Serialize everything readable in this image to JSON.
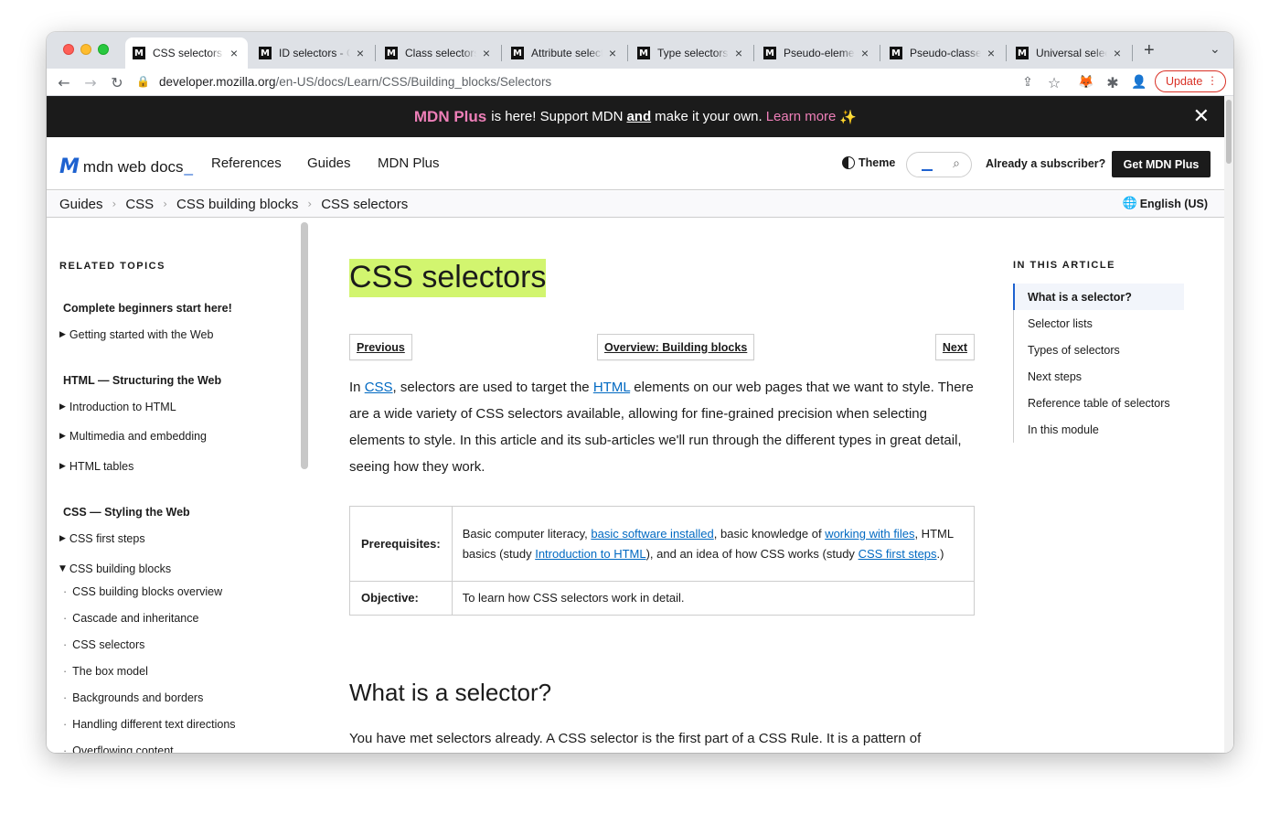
{
  "browser": {
    "tabs": [
      {
        "title": "CSS selectors - Learn web development",
        "active": true
      },
      {
        "title": "ID selectors - CSS: Cascading Style Sheets",
        "active": false
      },
      {
        "title": "Class selectors - CSS",
        "active": false
      },
      {
        "title": "Attribute selectors",
        "active": false
      },
      {
        "title": "Type selectors - CSS",
        "active": false
      },
      {
        "title": "Pseudo-elements - CSS",
        "active": false
      },
      {
        "title": "Pseudo-classes - CSS",
        "active": false
      },
      {
        "title": "Universal selectors",
        "active": false
      }
    ],
    "favicon_glyph": "M",
    "close_glyph": "×",
    "new_tab_glyph": "+",
    "tab_menu_glyph": "⌄",
    "back_glyph": "←",
    "forward_glyph": "→",
    "reload_glyph": "↻",
    "lock_glyph": "🔒",
    "url_host": "developer.mozilla.org",
    "url_path": "/en-US/docs/Learn/CSS/Building_blocks/Selectors",
    "share_glyph": "⇪",
    "star_glyph": "☆",
    "fox_glyph": "🦊",
    "puzzle_glyph": "✱",
    "avatar_glyph": "👤",
    "update_label": "Update",
    "update_menu_glyph": "⋮"
  },
  "banner": {
    "brand": "MDN Plus",
    "text_1": "is here! Support MDN",
    "and": "and",
    "text_2": "make it your own.",
    "learn_more": "Learn more",
    "sparkle": "✨",
    "close_glyph": "✕"
  },
  "nav": {
    "logo_mark": "M",
    "logo_text": "mdn web docs",
    "logo_cursor": "_",
    "links": [
      "References",
      "Guides",
      "MDN Plus"
    ],
    "theme_label": "Theme",
    "search_glyph": "⌕",
    "already_subscriber": "Already a subscriber?",
    "get_plus": "Get MDN Plus"
  },
  "breadcrumb": {
    "items": [
      "Guides",
      "CSS",
      "CSS building blocks",
      "CSS selectors"
    ],
    "separator": "›",
    "language": "English (US)",
    "globe_glyph": "🌐"
  },
  "sidebar": {
    "heading": "RELATED TOPICS",
    "group_1": "Complete beginners start here!",
    "item_getting_started": "Getting started with the Web",
    "group_2": "HTML — Structuring the Web",
    "item_intro_html": "Introduction to HTML",
    "item_multimedia": "Multimedia and embedding",
    "item_tables": "HTML tables",
    "group_3": "CSS — Styling the Web",
    "item_first_steps": "CSS first steps",
    "item_building_blocks": "CSS building blocks",
    "sub_items": [
      "CSS building blocks overview",
      "Cascade and inheritance",
      "CSS selectors",
      "The box model",
      "Backgrounds and borders",
      "Handling different text directions",
      "Overflowing content"
    ],
    "collapsed_glyph": "▶",
    "expanded_glyph": "▼",
    "dot_glyph": "·"
  },
  "article": {
    "title": "CSS selectors",
    "previous": "Previous",
    "overview": "Overview: Building blocks",
    "next": "Next",
    "intro_1": "In",
    "intro_link_css": "CSS",
    "intro_2": ", selectors are used to target the",
    "intro_link_html": "HTML",
    "intro_3": "elements on our web pages that we want to style. There are a wide variety of CSS selectors available, allowing for fine-grained precision when selecting elements to style. In this article and its sub-articles we'll run through the different types in great detail, seeing how they work.",
    "prereq_label": "Prerequisites:",
    "prereq_1": "Basic computer literacy,",
    "prereq_link_software": "basic software installed",
    "prereq_2": ", basic knowledge of",
    "prereq_link_files": "working with files",
    "prereq_3": ", HTML basics (study",
    "prereq_link_intro": "Introduction to HTML",
    "prereq_4": "), and an idea of how CSS works (study",
    "prereq_link_first": "CSS first steps",
    "prereq_5": ".)",
    "objective_label": "Objective:",
    "objective_text": "To learn how CSS selectors work in detail.",
    "h2": "What is a selector?",
    "para2": "You have met selectors already. A CSS selector is the first part of a CSS Rule. It is a pattern of"
  },
  "toc": {
    "heading": "IN THIS ARTICLE",
    "items": [
      "What is a selector?",
      "Selector lists",
      "Types of selectors",
      "Next steps",
      "Reference table of selectors",
      "In this module"
    ]
  }
}
